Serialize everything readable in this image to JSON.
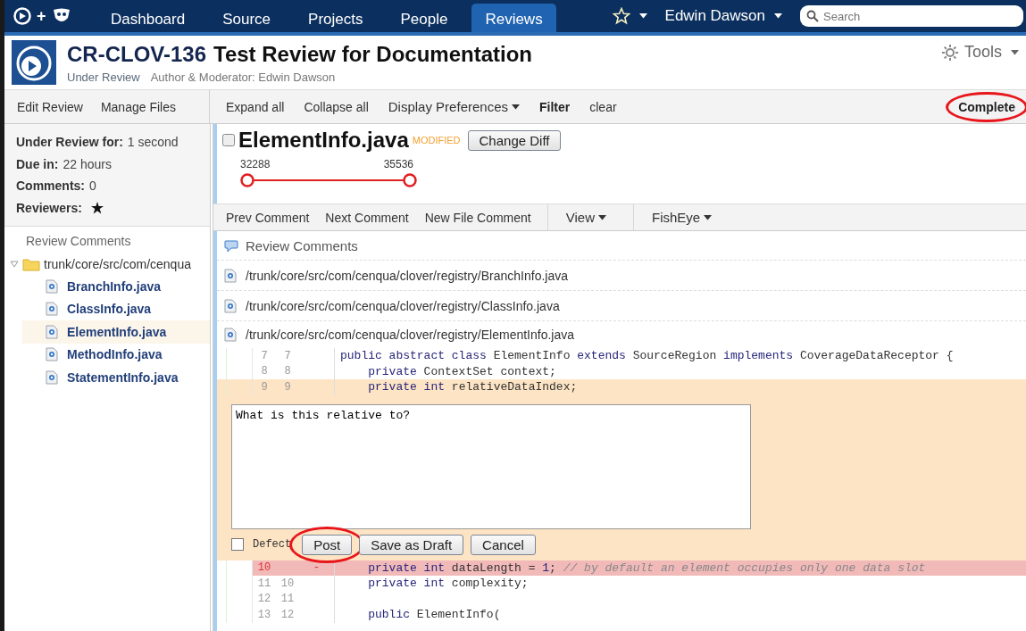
{
  "nav": {
    "logo_plus": "+",
    "items": [
      {
        "label": "Dashboard",
        "selected": false
      },
      {
        "label": "Source",
        "selected": false
      },
      {
        "label": "Projects",
        "selected": false
      },
      {
        "label": "People",
        "selected": false
      },
      {
        "label": "Reviews",
        "selected": true
      }
    ],
    "user": "Edwin Dawson",
    "search": {
      "placeholder": "Search"
    }
  },
  "header": {
    "key": "CR-CLOV-136",
    "title": "Test Review for Documentation",
    "status": "Under Review",
    "author": "Author & Moderator: Edwin Dawson",
    "tools": "Tools"
  },
  "toolbar": {
    "left": [
      "Edit Review",
      "Manage Files"
    ],
    "right": [
      {
        "label": "Expand all",
        "kind": "link"
      },
      {
        "label": "Collapse all",
        "kind": "link"
      },
      {
        "label": "Display Preferences",
        "kind": "menu"
      },
      {
        "label": "Filter",
        "kind": "bold"
      },
      {
        "label": "clear",
        "kind": "link"
      }
    ],
    "complete": {
      "label": "Complete",
      "circled": true
    }
  },
  "summary": [
    {
      "label": "Under Review for:",
      "value": "1 second",
      "kind": "text"
    },
    {
      "label": "Due in:",
      "value": "22 hours",
      "kind": "text"
    },
    {
      "label": "Comments:",
      "value": "0",
      "kind": "text"
    },
    {
      "label": "Reviewers:",
      "kind": "reviewers"
    }
  ],
  "tree": {
    "title": "Review Comments",
    "folder": {
      "label": "trunk/core/src/com/cenqua",
      "expanded": true,
      "children": [
        {
          "label": "BranchInfo.java",
          "selected": false
        },
        {
          "label": "ClassInfo.java",
          "selected": false
        },
        {
          "label": "ElementInfo.java",
          "selected": true
        },
        {
          "label": "MethodInfo.java",
          "selected": false
        },
        {
          "label": "StatementInfo.java",
          "selected": false
        }
      ]
    }
  },
  "file": {
    "name": "ElementInfo.java",
    "status": "MODIFIED",
    "change_button": "Change Diff",
    "revisions": [
      {
        "label": "32288",
        "level": 0
      },
      {
        "label": "35536",
        "level": 1
      }
    ]
  },
  "comment_toolbar": [
    {
      "label": "Prev Comment",
      "kind": "link"
    },
    {
      "label": "Next Comment",
      "kind": "link"
    },
    {
      "label": "New File Comment",
      "kind": "link"
    },
    {
      "label": "View",
      "kind": "menu"
    },
    {
      "label": "FishEye",
      "kind": "menu"
    }
  ],
  "review_comments": "Review Comments",
  "files": [
    {
      "path": "/trunk/core/src/com/cenqua/clover/registry/BranchInfo.java",
      "expanded": false
    },
    {
      "path": "/trunk/core/src/com/cenqua/clover/registry/ClassInfo.java",
      "expanded": false
    },
    {
      "path": "/trunk/core/src/com/cenqua/clover/registry/ElementInfo.java",
      "expanded": true
    }
  ],
  "code": {
    "lines_before": [
      {
        "old": "7",
        "new": "7",
        "kind": "context",
        "tokens": [
          {
            "kind": "keyword",
            "text": "public abstract class"
          },
          {
            "kind": "plain",
            "text": " ElementInfo "
          },
          {
            "kind": "keyword",
            "text": "extends"
          },
          {
            "kind": "plain",
            "text": " SourceRegion "
          },
          {
            "kind": "keyword",
            "text": "implements"
          },
          {
            "kind": "plain",
            "text": " CoverageDataReceptor {"
          }
        ]
      },
      {
        "old": "8",
        "new": "8",
        "kind": "context",
        "indented": true,
        "tokens": [
          {
            "kind": "keyword",
            "text": "private"
          },
          {
            "kind": "plain",
            "text": " ContextSet context;"
          }
        ]
      },
      {
        "old": "9",
        "new": "9",
        "kind": "highlighted",
        "indented": true,
        "tokens": [
          {
            "kind": "keyword",
            "text": "private int"
          },
          {
            "kind": "plain",
            "text": " relativeDataIndex;"
          }
        ]
      }
    ],
    "comment_form": {
      "value": "What is this relative to?",
      "defect": {
        "label": "Defect",
        "checked": false
      },
      "buttons": [
        {
          "label": "Post",
          "circled": true
        },
        {
          "label": "Save as Draft",
          "circled": false
        },
        {
          "label": "Cancel",
          "circled": false
        }
      ]
    },
    "lines_after": [
      {
        "old": "10",
        "marker": "-",
        "kind": "removed",
        "indented": true,
        "tokens": [
          {
            "kind": "keyword",
            "text": "private int"
          },
          {
            "kind": "plain",
            "text": " dataLength = "
          },
          {
            "kind": "number",
            "text": "1"
          },
          {
            "kind": "plain",
            "text": "; "
          },
          {
            "kind": "comment",
            "text": "// by default an element occupies only one data slot"
          }
        ]
      },
      {
        "old": "11",
        "new": "10",
        "kind": "context",
        "indented": true,
        "tokens": [
          {
            "kind": "keyword",
            "text": "private int"
          },
          {
            "kind": "plain",
            "text": " complexity;"
          }
        ]
      },
      {
        "old": "12",
        "new": "11",
        "kind": "context"
      },
      {
        "old": "13",
        "new": "12",
        "kind": "context",
        "indented": true,
        "tokens": [
          {
            "kind": "keyword",
            "text": "public"
          },
          {
            "kind": "plain",
            "text": " ElementInfo("
          }
        ]
      }
    ]
  }
}
